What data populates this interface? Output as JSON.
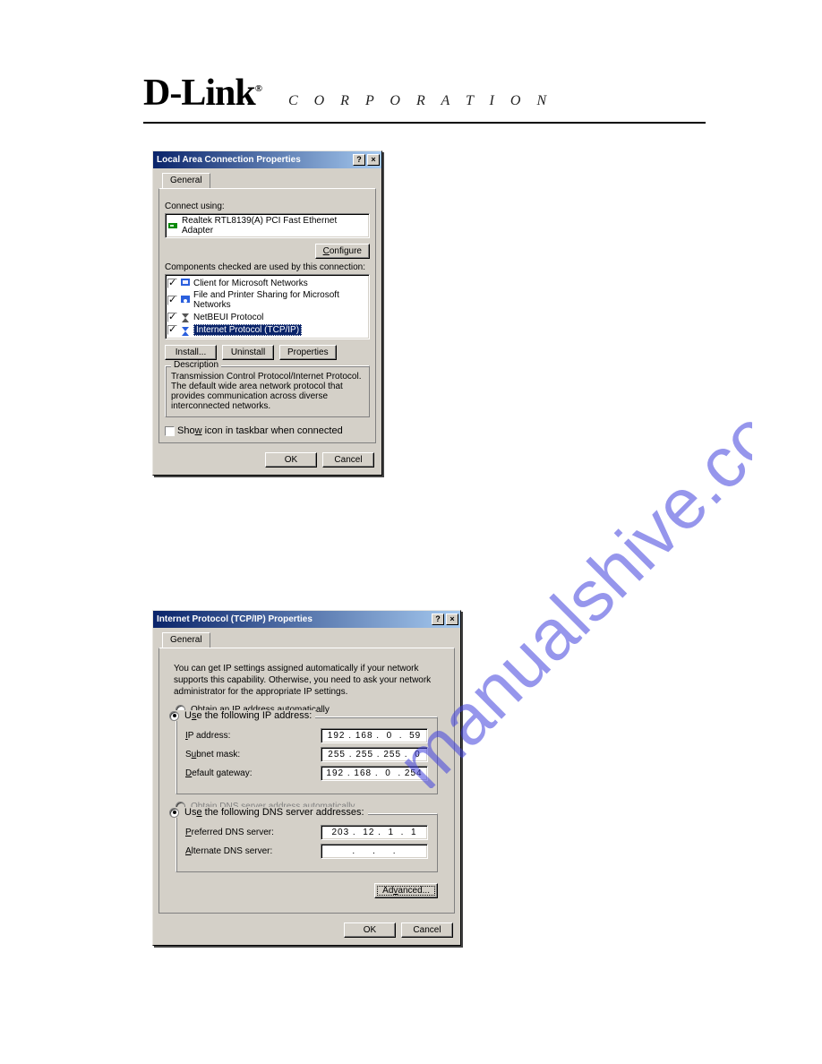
{
  "header": {
    "logo_text": "D-Link",
    "logo_trademark": "®",
    "corporation_text": "C O R P O R A T I O N"
  },
  "watermark_text": "manualshive.com",
  "dialog1": {
    "title": "Local Area Connection Properties",
    "help_btn": "?",
    "close_btn": "×",
    "tab_general": "General",
    "connect_using_label": "Connect using:",
    "adapter_text": "Realtek RTL8139(A) PCI Fast Ethernet Adapter",
    "configure_btn": "Configure",
    "components_label": "Components checked are used by this connection:",
    "items": [
      {
        "label": "Client for Microsoft Networks",
        "checked": true,
        "selected": false,
        "icon": "client"
      },
      {
        "label": "File and Printer Sharing for Microsoft Networks",
        "checked": true,
        "selected": false,
        "icon": "share"
      },
      {
        "label": "NetBEUI Protocol",
        "checked": true,
        "selected": false,
        "icon": "proto"
      },
      {
        "label": "Internet Protocol (TCP/IP)",
        "checked": true,
        "selected": true,
        "icon": "proto"
      }
    ],
    "install_btn": "Install...",
    "uninstall_btn": "Uninstall",
    "properties_btn": "Properties",
    "description_title": "Description",
    "description_text": "Transmission Control Protocol/Internet Protocol. The default wide area network protocol that provides communication across diverse interconnected networks.",
    "show_icon_label": "Show icon in taskbar when connected",
    "ok_btn": "OK",
    "cancel_btn": "Cancel"
  },
  "dialog2": {
    "title": "Internet Protocol (TCP/IP) Properties",
    "help_btn": "?",
    "close_btn": "×",
    "tab_general": "General",
    "intro_text": "You can get IP settings assigned automatically if your network supports this capability. Otherwise, you need to ask your network administrator for the appropriate IP settings.",
    "r_obtain_ip": "Obtain an IP address automatically",
    "r_use_ip": "Use the following IP address:",
    "ip_address_label": "IP address:",
    "ip_address_value": "192 . 168 .  0  .  59",
    "subnet_label": "Subnet mask:",
    "subnet_value": "255 . 255 . 255 .  0",
    "gateway_label": "Default gateway:",
    "gateway_value": "192 . 168 .  0  . 254",
    "r_obtain_dns": "Obtain DNS server address automatically",
    "r_use_dns": "Use the following DNS server addresses:",
    "pref_dns_label": "Preferred DNS server:",
    "pref_dns_value": "203 .  12 .  1  .  1",
    "alt_dns_label": "Alternate DNS server:",
    "alt_dns_value": "   .     .     .   ",
    "advanced_btn": "Advanced...",
    "ok_btn": "OK",
    "cancel_btn": "Cancel"
  }
}
